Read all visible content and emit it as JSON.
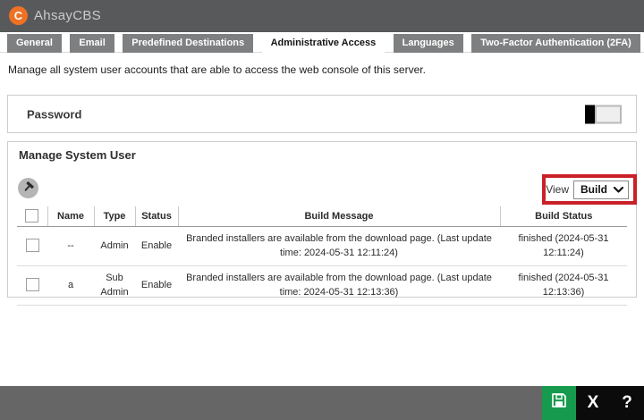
{
  "header": {
    "logo_letter": "C",
    "app_title": "AhsayCBS"
  },
  "tabs": [
    {
      "label": "General",
      "active": false
    },
    {
      "label": "Email",
      "active": false
    },
    {
      "label": "Predefined Destinations",
      "active": false
    },
    {
      "label": "Administrative Access",
      "active": true
    },
    {
      "label": "Languages",
      "active": false
    },
    {
      "label": "Two-Factor Authentication (2FA)",
      "active": false
    }
  ],
  "description": "Manage all system user accounts that are able to access the web console of this server.",
  "password_section": {
    "title": "Password",
    "toggle_state": "off"
  },
  "manage_section": {
    "title": "Manage System User",
    "view_label": "View",
    "view_selected": "Build",
    "table": {
      "headers": [
        "Name",
        "Type",
        "Status",
        "Build Message",
        "Build Status"
      ],
      "rows": [
        {
          "name": "--",
          "type": "Admin",
          "status": "Enable",
          "build_message": "Branded installers are available from the download page. (Last update time: 2024-05-31 12:11:24)",
          "build_status": "finished (2024-05-31 12:11:24)"
        },
        {
          "name": "a",
          "type": "Sub Admin",
          "status": "Enable",
          "build_message": "Branded installers are available from the download page. (Last update time: 2024-05-31 12:13:36)",
          "build_status": "finished (2024-05-31 12:13:36)"
        }
      ]
    }
  },
  "footer": {
    "close_label": "X",
    "help_label": "?"
  },
  "icons": {
    "logo": "ahsay-c-logo",
    "build": "hammer",
    "dropdown": "chevron-down",
    "save": "floppy-disk"
  },
  "colors": {
    "header_gray": "#58595B",
    "tab_gray": "#7E7F80",
    "accent_orange": "#EE7124",
    "highlight_red": "#C92128",
    "save_green": "#169A4E",
    "footer_gray": "#666666"
  }
}
